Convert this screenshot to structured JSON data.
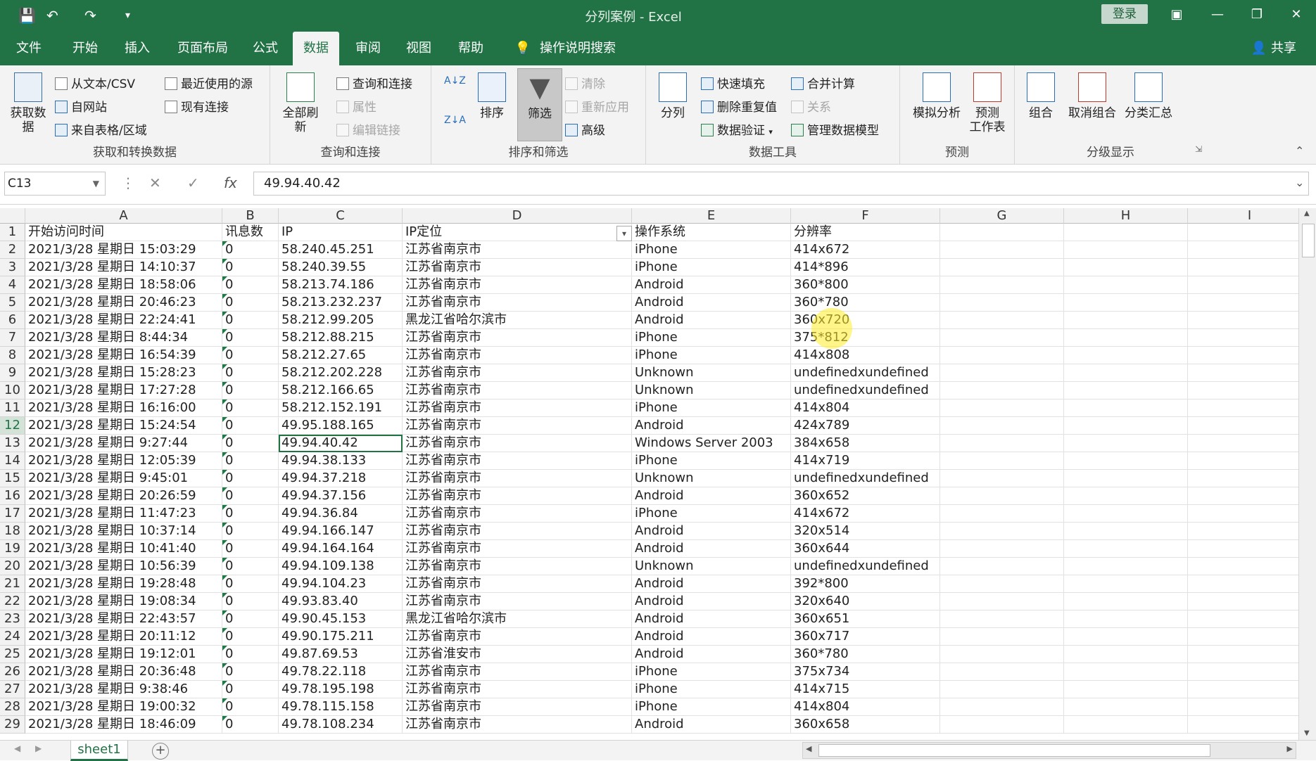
{
  "window": {
    "title": "分列案例  -  Excel",
    "login_label": "登录",
    "share_label": "共享",
    "icons": [
      "save-icon",
      "undo-icon",
      "redo-icon",
      "customize-qat-icon",
      "ribbon-display-icon",
      "minimize-icon",
      "restore-icon",
      "close-icon"
    ]
  },
  "tabs": [
    "文件",
    "开始",
    "插入",
    "页面布局",
    "公式",
    "数据",
    "审阅",
    "视图",
    "帮助",
    "操作说明搜索"
  ],
  "ribbon": {
    "groups": {
      "get_transform": "获取和转换数据",
      "query": "查询和连接",
      "sort_filter": "排序和筛选",
      "data_tools": "数据工具",
      "forecast": "预测",
      "outline": "分级显示"
    },
    "get": {
      "get_data": "获取数",
      "get_data2": "据",
      "from_text": "从文本/CSV",
      "from_web": "自网站",
      "from_table": "来自表格/区域",
      "recent": "最近使用的源",
      "existing": "现有连接"
    },
    "query": {
      "refresh_all": "全部刷新",
      "queries": "查询和连接",
      "properties": "属性",
      "edit_links": "编辑链接"
    },
    "sort": {
      "sort": "排序",
      "filter": "筛选",
      "clear": "清除",
      "reapply": "重新应用",
      "advanced": "高级"
    },
    "tools": {
      "text_to_columns": "分列",
      "flash_fill": "快速填充",
      "remove_dup": "删除重复值",
      "validation": "数据验证",
      "consolidate": "合并计算",
      "relations": "关系",
      "data_model": "管理数据模型"
    },
    "forecast": {
      "whatif": "模拟分析",
      "sheet1": "预测",
      "sheet2": "工作表"
    },
    "outline": {
      "group": "组合",
      "ungroup": "取消组合",
      "subtotal": "分类汇总"
    }
  },
  "formula_bar": {
    "name_box": "C13",
    "value": "49.94.40.42"
  },
  "columns": [
    "A",
    "B",
    "C",
    "D",
    "E",
    "F",
    "G",
    "H",
    "I"
  ],
  "header_row": [
    "开始访问时间",
    "讯息数",
    "IP",
    "IP定位",
    "操作系统",
    "分辨率"
  ],
  "rows": [
    [
      "2021/3/28 星期日 15:03:29",
      "0",
      "58.240.45.251",
      "江苏省南京市",
      "iPhone",
      "414x672"
    ],
    [
      "2021/3/28 星期日 14:10:37",
      "0",
      "58.240.39.55",
      "江苏省南京市",
      "iPhone",
      "414*896"
    ],
    [
      "2021/3/28 星期日 18:58:06",
      "0",
      "58.213.74.186",
      "江苏省南京市",
      "Android",
      "360*800"
    ],
    [
      "2021/3/28 星期日 20:46:23",
      "0",
      "58.213.232.237",
      "江苏省南京市",
      "Android",
      "360*780"
    ],
    [
      "2021/3/28 星期日 22:24:41",
      "0",
      "58.212.99.205",
      "黑龙江省哈尔滨市",
      "Android",
      "360x720"
    ],
    [
      "2021/3/28 星期日 8:44:34",
      "0",
      "58.212.88.215",
      "江苏省南京市",
      "iPhone",
      "375*812"
    ],
    [
      "2021/3/28 星期日 16:54:39",
      "0",
      "58.212.27.65",
      "江苏省南京市",
      "iPhone",
      "414x808"
    ],
    [
      "2021/3/28 星期日 15:28:23",
      "0",
      "58.212.202.228",
      "江苏省南京市",
      "Unknown",
      "undefinedxundefined"
    ],
    [
      "2021/3/28 星期日 17:27:28",
      "0",
      "58.212.166.65",
      "江苏省南京市",
      "Unknown",
      "undefinedxundefined"
    ],
    [
      "2021/3/28 星期日 16:16:00",
      "0",
      "58.212.152.191",
      "江苏省南京市",
      "iPhone",
      "414x804"
    ],
    [
      "2021/3/28 星期日 15:24:54",
      "0",
      "49.95.188.165",
      "江苏省南京市",
      "Android",
      "424x789"
    ],
    [
      "2021/3/28 星期日 9:27:44",
      "0",
      "49.94.40.42",
      "江苏省南京市",
      "Windows Server 2003",
      "384x658"
    ],
    [
      "2021/3/28 星期日 12:05:39",
      "0",
      "49.94.38.133",
      "江苏省南京市",
      "iPhone",
      "414x719"
    ],
    [
      "2021/3/28 星期日 9:45:01",
      "0",
      "49.94.37.218",
      "江苏省南京市",
      "Unknown",
      "undefinedxundefined"
    ],
    [
      "2021/3/28 星期日 20:26:59",
      "0",
      "49.94.37.156",
      "江苏省南京市",
      "Android",
      "360x652"
    ],
    [
      "2021/3/28 星期日 11:47:23",
      "0",
      "49.94.36.84",
      "江苏省南京市",
      "iPhone",
      "414x672"
    ],
    [
      "2021/3/28 星期日 10:37:14",
      "0",
      "49.94.166.147",
      "江苏省南京市",
      "Android",
      "320x514"
    ],
    [
      "2021/3/28 星期日 10:41:40",
      "0",
      "49.94.164.164",
      "江苏省南京市",
      "Android",
      "360x644"
    ],
    [
      "2021/3/28 星期日 10:56:39",
      "0",
      "49.94.109.138",
      "江苏省南京市",
      "Unknown",
      "undefinedxundefined"
    ],
    [
      "2021/3/28 星期日 19:28:48",
      "0",
      "49.94.104.23",
      "江苏省南京市",
      "Android",
      "392*800"
    ],
    [
      "2021/3/28 星期日 19:08:34",
      "0",
      "49.93.83.40",
      "江苏省南京市",
      "Android",
      "320x640"
    ],
    [
      "2021/3/28 星期日 22:43:57",
      "0",
      "49.90.45.153",
      "黑龙江省哈尔滨市",
      "Android",
      "360x651"
    ],
    [
      "2021/3/28 星期日 20:11:12",
      "0",
      "49.90.175.211",
      "江苏省南京市",
      "Android",
      "360x717"
    ],
    [
      "2021/3/28 星期日 19:12:01",
      "0",
      "49.87.69.53",
      "江苏省淮安市",
      "Android",
      "360*780"
    ],
    [
      "2021/3/28 星期日 20:36:48",
      "0",
      "49.78.22.118",
      "江苏省南京市",
      "iPhone",
      "375x734"
    ],
    [
      "2021/3/28 星期日 9:38:46",
      "0",
      "49.78.195.198",
      "江苏省南京市",
      "iPhone",
      "414x715"
    ],
    [
      "2021/3/28 星期日 19:00:32",
      "0",
      "49.78.115.158",
      "江苏省南京市",
      "iPhone",
      "414x804"
    ],
    [
      "2021/3/28 星期日 18:46:09",
      "0",
      "49.78.108.234",
      "江苏省南京市",
      "Android",
      "360x658"
    ]
  ],
  "sheet_tab": "sheet1",
  "colors": {
    "accent": "#217346",
    "triangle": "#1e7b45"
  }
}
